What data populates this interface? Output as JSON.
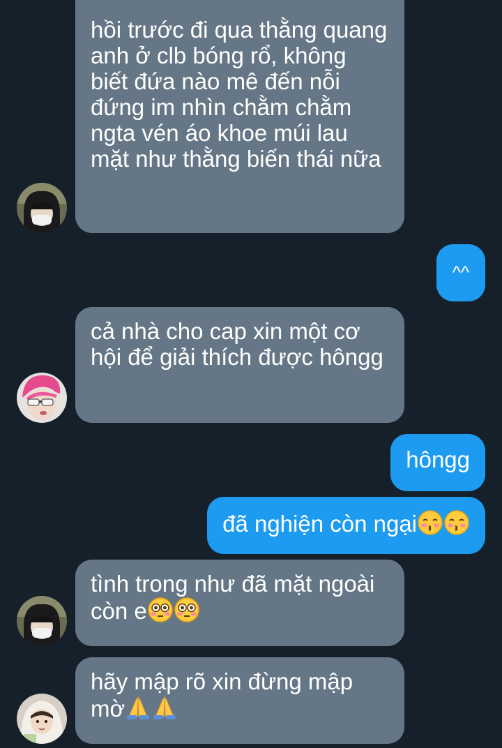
{
  "messages": [
    {
      "direction": "incoming",
      "text": "hồi trước đi qua thằng quang anh ở clb bóng rổ, không biết đứa nào mê đến nỗi đứng im nhìn chằm chằm ngta vén áo khoe múi lau mặt như thằng biến thái nữa",
      "avatar": "black-hair-masked-user-avatar"
    },
    {
      "direction": "outgoing",
      "text": "^^"
    },
    {
      "direction": "incoming",
      "text": "cả nhà cho cap xin một cơ hội để giải thích được hôngg",
      "avatar": "pink-hair-sunglasses-user-avatar"
    },
    {
      "direction": "outgoing",
      "text": "hôngg"
    },
    {
      "direction": "outgoing",
      "text": "đã nghiện còn ngại",
      "emojis": [
        "kissing-face-closed-eyes",
        "kissing-face-closed-eyes"
      ]
    },
    {
      "direction": "incoming",
      "text": "tình trong như đã mặt ngoài còn e",
      "emojis": [
        "flushed-face",
        "flushed-face"
      ],
      "avatar": "black-hair-masked-user-avatar"
    },
    {
      "direction": "incoming",
      "text": "hãy mập rõ xin đừng mập mờ",
      "emojis": [
        "folded-hands",
        "folded-hands"
      ],
      "avatar": "light-hoodie-user-avatar"
    }
  ],
  "colors": {
    "background": "#15202b",
    "incoming_bubble": "#657786",
    "outgoing_bubble": "#1d9bf0",
    "text": "#ffffff"
  }
}
